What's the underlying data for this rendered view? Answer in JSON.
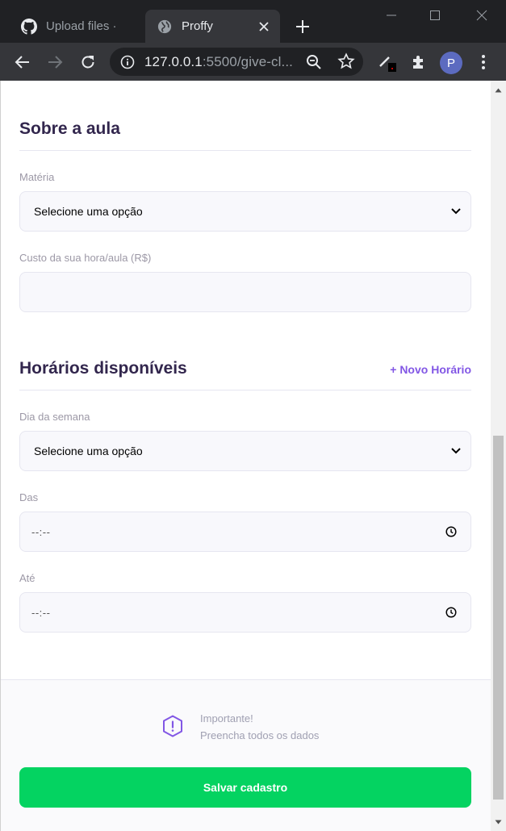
{
  "browser": {
    "tabs": [
      {
        "title": "Upload files · ",
        "icon": "github-icon"
      },
      {
        "title": "Proffy",
        "icon": "globe-icon"
      }
    ],
    "url_host": "127.0.0.1",
    "url_rest": ":5500/give-cl...",
    "profile_initial": "P"
  },
  "page": {
    "about_section": {
      "title": "Sobre a aula",
      "subject_label": "Matéria",
      "subject_value": "Selecione uma opção",
      "cost_label": "Custo da sua hora/aula (R$)",
      "cost_value": ""
    },
    "schedule_section": {
      "title": "Horários disponíveis",
      "add_link": "+ Novo Horário",
      "weekday_label": "Dia da semana",
      "weekday_value": "Selecione uma opção",
      "from_label": "Das",
      "from_value": "--:--",
      "to_label": "Até",
      "to_value": "--:--"
    },
    "footer": {
      "warning_title": "Importante!",
      "warning_text": "Preencha todos os dados",
      "save_label": "Salvar cadastro"
    }
  },
  "colors": {
    "title": "#32264d",
    "accent": "#8257e5",
    "save_button": "#04d361",
    "label": "#9c98a6",
    "input_bg": "#f8f8fc"
  }
}
